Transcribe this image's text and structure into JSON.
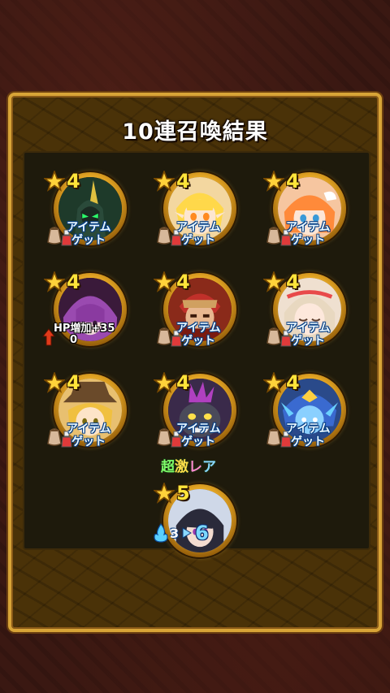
{
  "title": "10連召喚結果",
  "results": [
    {
      "stars": "4",
      "bonus_type": "item",
      "bonus_line1": "アイテム",
      "bonus_line2": "ゲット",
      "character": "green-robot-knight",
      "bg": "#1e3a2a",
      "accent": "#e0c040"
    },
    {
      "stars": "4",
      "bonus_type": "item",
      "bonus_line1": "アイテム",
      "bonus_line2": "ゲット",
      "character": "blonde-elf-girl",
      "bg": "#f3d7a0",
      "accent": "#ffd84a"
    },
    {
      "stars": "4",
      "bonus_type": "item",
      "bonus_line1": "アイテム",
      "bonus_line2": "ゲット",
      "character": "orange-hair-maid",
      "bg": "#f6c6a0",
      "accent": "#ff8a3a"
    },
    {
      "stars": "4",
      "bonus_type": "hp",
      "bonus_line1": "HP増加+35",
      "bonus_line2": "0",
      "character": "purple-hair-mage",
      "bg": "#3a1a3a",
      "accent": "#9a4ab0"
    },
    {
      "stars": "4",
      "bonus_type": "item",
      "bonus_line1": "アイテム",
      "bonus_line2": "ゲット",
      "character": "red-armored-warrior",
      "bg": "#8a2a1a",
      "accent": "#d0a060"
    },
    {
      "stars": "4",
      "bonus_type": "item",
      "bonus_line1": "アイテム",
      "bonus_line2": "ゲット",
      "character": "sleeping-white-hair-girl",
      "bg": "#efe0d0",
      "accent": "#e84a4a"
    },
    {
      "stars": "4",
      "bonus_type": "item",
      "bonus_line1": "アイテム",
      "bonus_line2": "ゲット",
      "character": "blonde-hat-boy",
      "bg": "#e8c070",
      "accent": "#6a4a2a"
    },
    {
      "stars": "4",
      "bonus_type": "item",
      "bonus_line1": "アイテム",
      "bonus_line2": "ゲット",
      "character": "dark-purple-beast",
      "bg": "#3a2a4a",
      "accent": "#b040c0"
    },
    {
      "stars": "4",
      "bonus_type": "item",
      "bonus_line1": "アイテム",
      "bonus_line2": "ゲット",
      "character": "blue-dragon-knight",
      "bg": "#2a4a8a",
      "accent": "#6ad0ff"
    },
    {
      "stars": "5",
      "bonus_type": "evolve",
      "rare_label": "超激レア",
      "evo_from": "3",
      "evo_to": "6",
      "character": "dark-hair-swordsman",
      "bg": "#cfd8e8",
      "accent": "#2a2a3a"
    }
  ],
  "colors": {
    "gold": "#d8a437",
    "star": "#ffe43a",
    "item_text": "#eaf8ff"
  }
}
